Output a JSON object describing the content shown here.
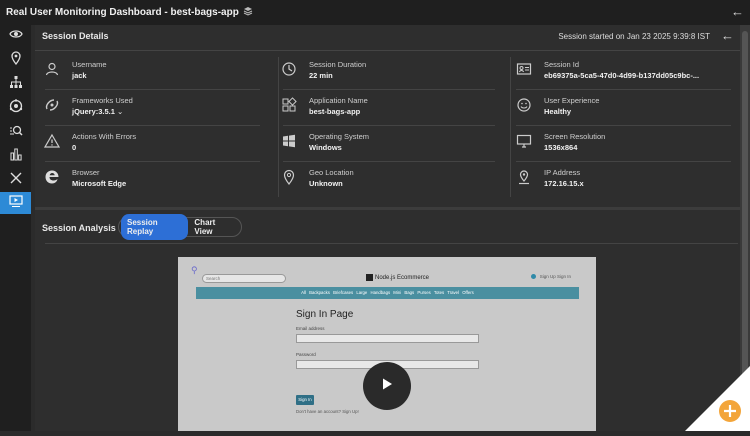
{
  "window": {
    "title": "Real User Monitoring Dashboard - best-bags-app",
    "stack_icon": "stack-icon",
    "back_icon": "arrow-left-icon"
  },
  "sidebar": {
    "items": [
      {
        "icon": "eye-icon"
      },
      {
        "icon": "location-pin-icon"
      },
      {
        "icon": "hierarchy-icon"
      },
      {
        "icon": "network-icon"
      },
      {
        "icon": "search-analysis-icon"
      },
      {
        "icon": "bar-chart-icon"
      },
      {
        "icon": "close-icon"
      },
      {
        "icon": "session-replay-icon",
        "active": true
      }
    ],
    "active_color": "#2d8ad6"
  },
  "session_details": {
    "title": "Session Details",
    "started": "Session started on Jan 23 2025 9:39:8 IST",
    "fields": [
      {
        "label": "Username",
        "value": "jack",
        "icon": "user-icon"
      },
      {
        "label": "Session Duration",
        "value": "22 min",
        "icon": "clock-icon"
      },
      {
        "label": "Session Id",
        "value": "eb69375a-5ca5-47d0-4d99-b137dd05c9bc-...",
        "icon": "id-card-icon"
      },
      {
        "label": "Frameworks Used",
        "value": "jQuery:3.5.1",
        "icon": "react-icon"
      },
      {
        "label": "Application Name",
        "value": "best-bags-app",
        "icon": "apps-grid-icon"
      },
      {
        "label": "User Experience",
        "value": "Healthy",
        "icon": "smiley-icon"
      },
      {
        "label": "Actions With Errors",
        "value": "0",
        "icon": "warning-icon"
      },
      {
        "label": "Operating System",
        "value": "Windows",
        "icon": "windows-icon"
      },
      {
        "label": "Screen Resolution",
        "value": "1536x864",
        "icon": "monitor-icon"
      },
      {
        "label": "Browser",
        "value": "Microsoft Edge",
        "icon": "edge-icon"
      },
      {
        "label": "Geo Location",
        "value": "Unknown",
        "icon": "location-pin-icon"
      },
      {
        "label": "IP Address",
        "value": "172.16.15.x",
        "icon": "ip-location-icon"
      }
    ]
  },
  "session_analysis": {
    "title": "Session Analysis",
    "tabs": [
      {
        "label": "Session Replay",
        "active": true
      },
      {
        "label": "Chart View",
        "active": false
      }
    ],
    "accent": "#2d6fd6"
  },
  "replay": {
    "search_placeholder": "Search",
    "brand": "Node.js Ecommerce",
    "links": "Sign Up   Sign In",
    "nav": "All   Backpacks   Briefcases   Large Handbags   Mini Bags   Purses   Totes   Travel   Offers",
    "heading": "Sign In Page",
    "email_label": "Email address",
    "password_label": "Password",
    "button": "Sign In",
    "note": "Don't have an account? Sign Up!",
    "play_icon": "play-icon"
  },
  "corner": {
    "icon": "zoom-plus-icon",
    "color": "#f3a53a"
  }
}
